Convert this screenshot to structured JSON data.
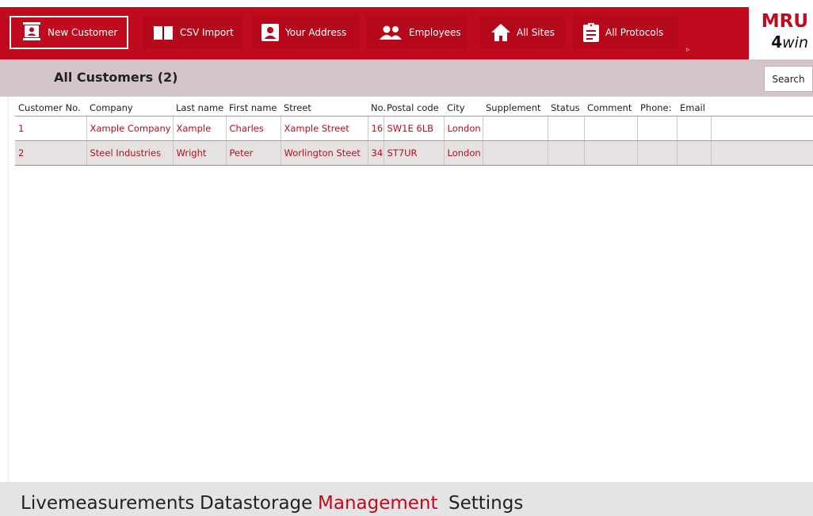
{
  "toolbar": {
    "buttons": [
      {
        "label": "New Customer",
        "icon": "contact-card-icon"
      },
      {
        "label": "CSV Import",
        "icon": "book-icon"
      },
      {
        "label": "Your Address",
        "icon": "person-badge-icon"
      },
      {
        "label": "Employees",
        "icon": "people-icon"
      },
      {
        "label": "All Sites",
        "icon": "home-icon"
      },
      {
        "label": "All Protocols",
        "icon": "clipboard-icon"
      }
    ],
    "more": "▹"
  },
  "logo": {
    "top": "MRU",
    "bottom_num": "4",
    "bottom_word": "win"
  },
  "customers": {
    "title": "All Customers (2)",
    "search_label": "Search"
  },
  "table": {
    "headers": [
      "Customer No.",
      "Company",
      "Last name",
      "First name",
      "Street",
      "No.",
      "Postal code",
      "City",
      "Supplement",
      "Status",
      "Comment",
      "Phone:",
      "Email",
      ""
    ],
    "rows": [
      [
        "1",
        "Xample Company",
        "Xample",
        "Charles",
        "Xample Street",
        "16",
        "SW1E 6LB",
        "London",
        "",
        "",
        "",
        "",
        "",
        ""
      ],
      [
        "2",
        "Steel Industries",
        "Wright",
        "Peter",
        "Worlington Steet",
        "34",
        "ST7UR",
        "London",
        "",
        "",
        "",
        "",
        "",
        ""
      ]
    ]
  },
  "bottomnav": {
    "items": [
      "Livemeasurements",
      "Datastorage",
      "Management",
      "Settings"
    ],
    "active": "Management"
  },
  "colors": {
    "accent": "#c00b1e",
    "header_bar": "#d4c6c8",
    "nav_bg": "#e4e4e4"
  }
}
